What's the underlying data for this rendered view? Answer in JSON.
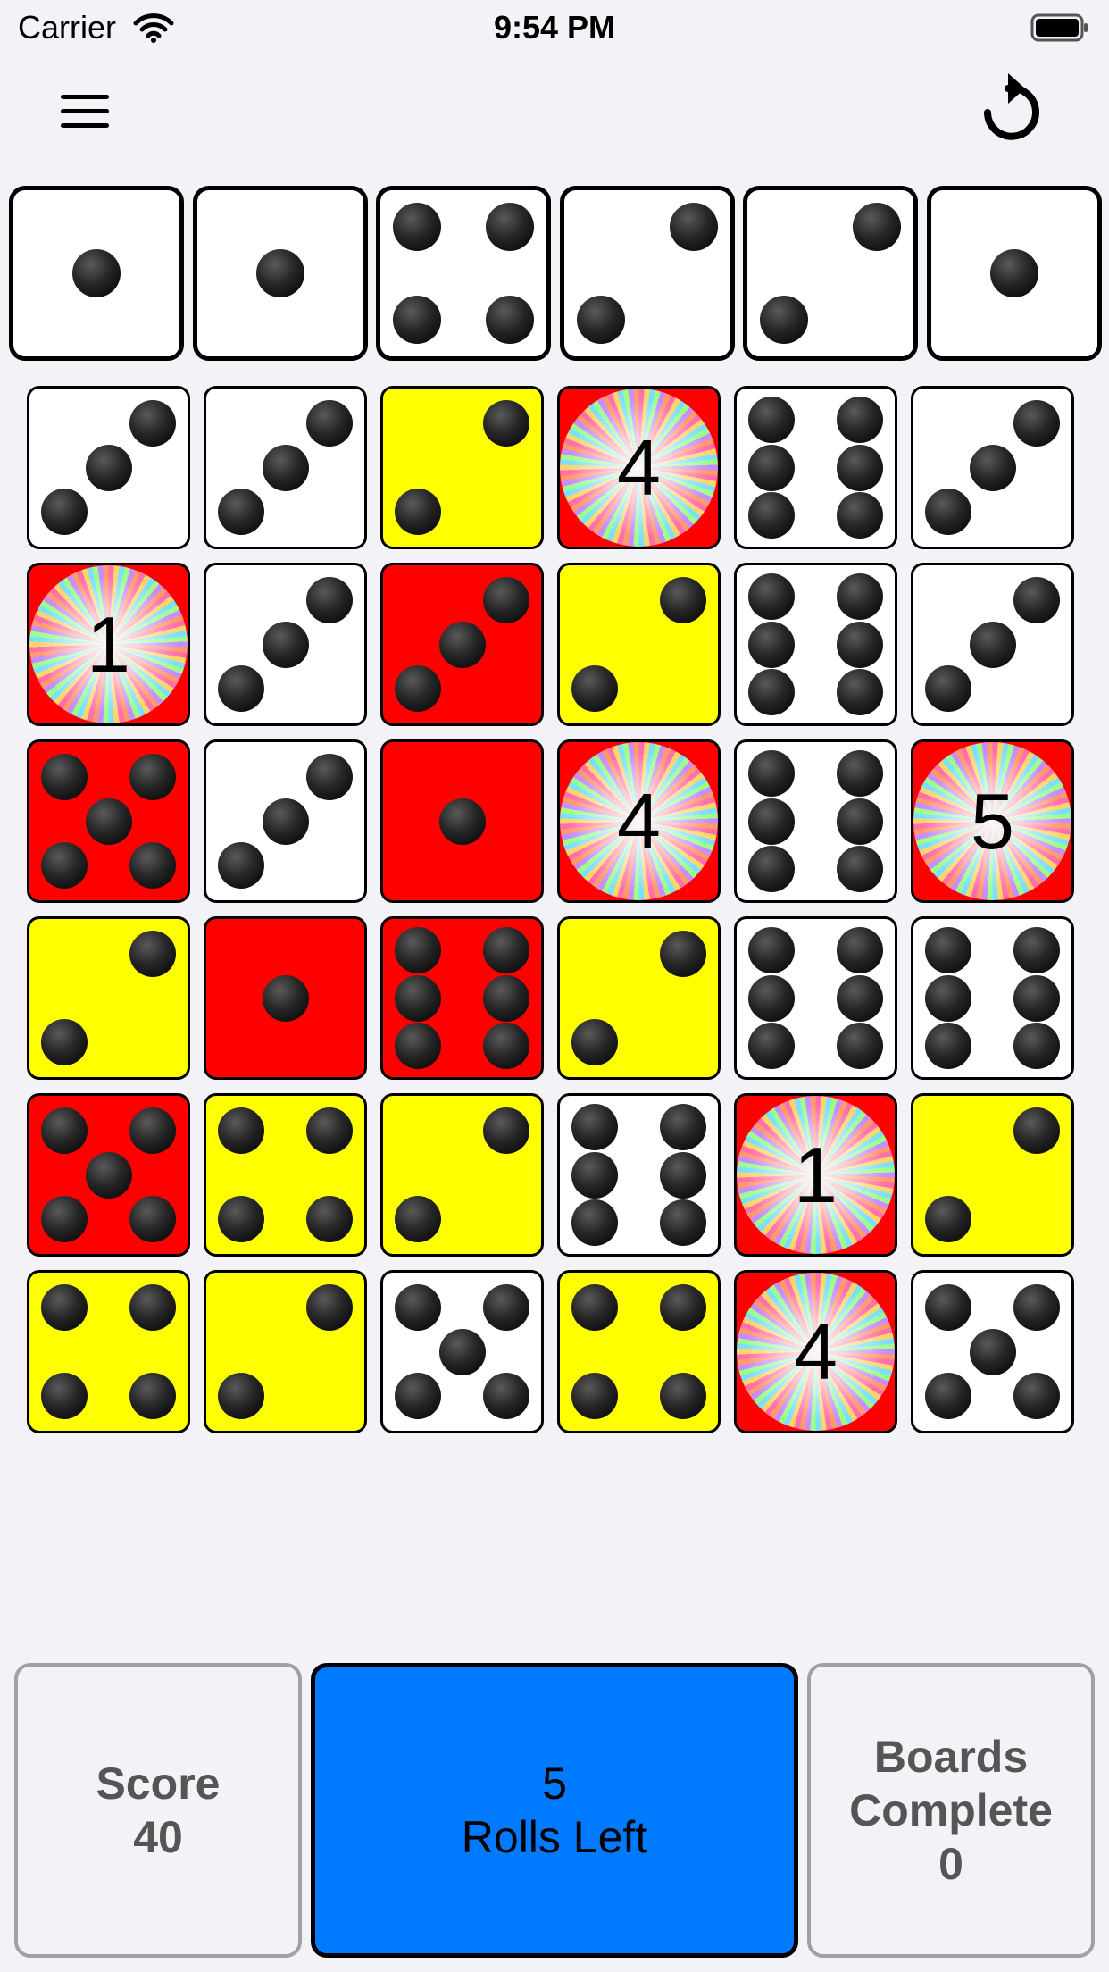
{
  "status_bar": {
    "carrier": "Carrier",
    "time": "9:54 PM"
  },
  "toolbar": {
    "menu_icon": "hamburger-menu-icon",
    "reset_icon": "reset-arrow-icon"
  },
  "colors": {
    "white": "#ffffff",
    "yellow": "#ffff00",
    "red": "#ff0000",
    "blue": "#007aff",
    "background": "#f2f2f7"
  },
  "top_dice": [
    1,
    1,
    4,
    2,
    2,
    1
  ],
  "board": [
    [
      {
        "color": "white",
        "value": 3
      },
      {
        "color": "white",
        "value": 3
      },
      {
        "color": "yellow",
        "value": 2
      },
      {
        "color": "red",
        "wheel": "4"
      },
      {
        "color": "white",
        "value": 6
      },
      {
        "color": "white",
        "value": 3
      }
    ],
    [
      {
        "color": "red",
        "wheel": "1"
      },
      {
        "color": "white",
        "value": 3
      },
      {
        "color": "red",
        "value": 3
      },
      {
        "color": "yellow",
        "value": 2
      },
      {
        "color": "white",
        "value": 6
      },
      {
        "color": "white",
        "value": 3
      }
    ],
    [
      {
        "color": "red",
        "value": 5
      },
      {
        "color": "white",
        "value": 3
      },
      {
        "color": "red",
        "value": 1
      },
      {
        "color": "red",
        "wheel": "4"
      },
      {
        "color": "white",
        "value": 6
      },
      {
        "color": "red",
        "wheel": "5"
      }
    ],
    [
      {
        "color": "yellow",
        "value": 2
      },
      {
        "color": "red",
        "value": 1
      },
      {
        "color": "red",
        "value": 6
      },
      {
        "color": "yellow",
        "value": 2
      },
      {
        "color": "white",
        "value": 6
      },
      {
        "color": "white",
        "value": 6
      }
    ],
    [
      {
        "color": "red",
        "value": 5
      },
      {
        "color": "yellow",
        "value": 4
      },
      {
        "color": "yellow",
        "value": 2
      },
      {
        "color": "white",
        "value": 6
      },
      {
        "color": "red",
        "wheel": "1"
      },
      {
        "color": "yellow",
        "value": 2
      }
    ],
    [
      {
        "color": "yellow",
        "value": 4
      },
      {
        "color": "yellow",
        "value": 2
      },
      {
        "color": "white",
        "value": 5
      },
      {
        "color": "yellow",
        "value": 4
      },
      {
        "color": "red",
        "wheel": "4"
      },
      {
        "color": "white",
        "value": 5
      }
    ]
  ],
  "buttons": {
    "score_label": "Score",
    "score_value": "40",
    "rolls_value": "5",
    "rolls_label": "Rolls Left",
    "boards_label_1": "Boards",
    "boards_label_2": "Complete",
    "boards_value": "0"
  }
}
